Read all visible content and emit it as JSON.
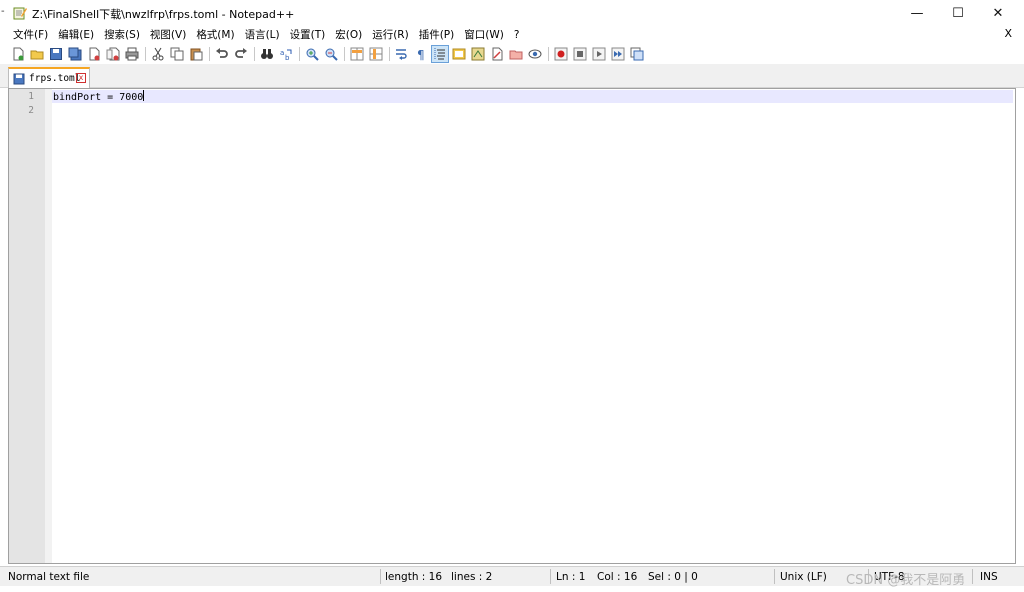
{
  "window": {
    "edge_mark": "-",
    "title": "Z:\\FinalShell下载\\nwzlfrp\\frps.toml - Notepad++",
    "min_glyph": "—",
    "max_glyph": "☐",
    "close_glyph": "✕"
  },
  "menu": {
    "items": [
      "文件(F)",
      "编辑(E)",
      "搜索(S)",
      "视图(V)",
      "格式(M)",
      "语言(L)",
      "设置(T)",
      "宏(O)",
      "运行(R)",
      "插件(P)",
      "窗口(W)",
      "?"
    ],
    "close_label": "X"
  },
  "toolbar": {
    "buttons": [
      "new-file",
      "open-file",
      "save",
      "save-all",
      "close",
      "close-all",
      "print",
      "cut",
      "copy",
      "paste",
      "undo",
      "redo",
      "find",
      "replace",
      "zoom-in",
      "zoom-out",
      "sync-vertical",
      "sync-horizontal",
      "word-wrap",
      "show-all-chars",
      "indent-guide",
      "doc-map",
      "function-list",
      "folder-as-workspace",
      "monitoring",
      "macro-record",
      "macro-stop",
      "macro-play",
      "macro-run-multiple",
      "macro-save"
    ]
  },
  "tab": {
    "label": "frps.toml",
    "close_glyph": "x"
  },
  "editor": {
    "lines": [
      {
        "number": "1",
        "text": "bindPort = 7000"
      },
      {
        "number": "2",
        "text": ""
      }
    ]
  },
  "status": {
    "file_type": "Normal text file",
    "length": "length : 16",
    "lines": "lines : 2",
    "ln": "Ln : 1",
    "col": "Col : 16",
    "sel": "Sel : 0 | 0",
    "eol": "Unix (LF)",
    "encoding": "UTF-8",
    "mode": "INS"
  },
  "watermark": "CSDN @我不是阿勇",
  "colors": {
    "tab_accent": "#f6a623",
    "current_line": "#e8e8ff",
    "gutter": "#e4e4e4"
  }
}
